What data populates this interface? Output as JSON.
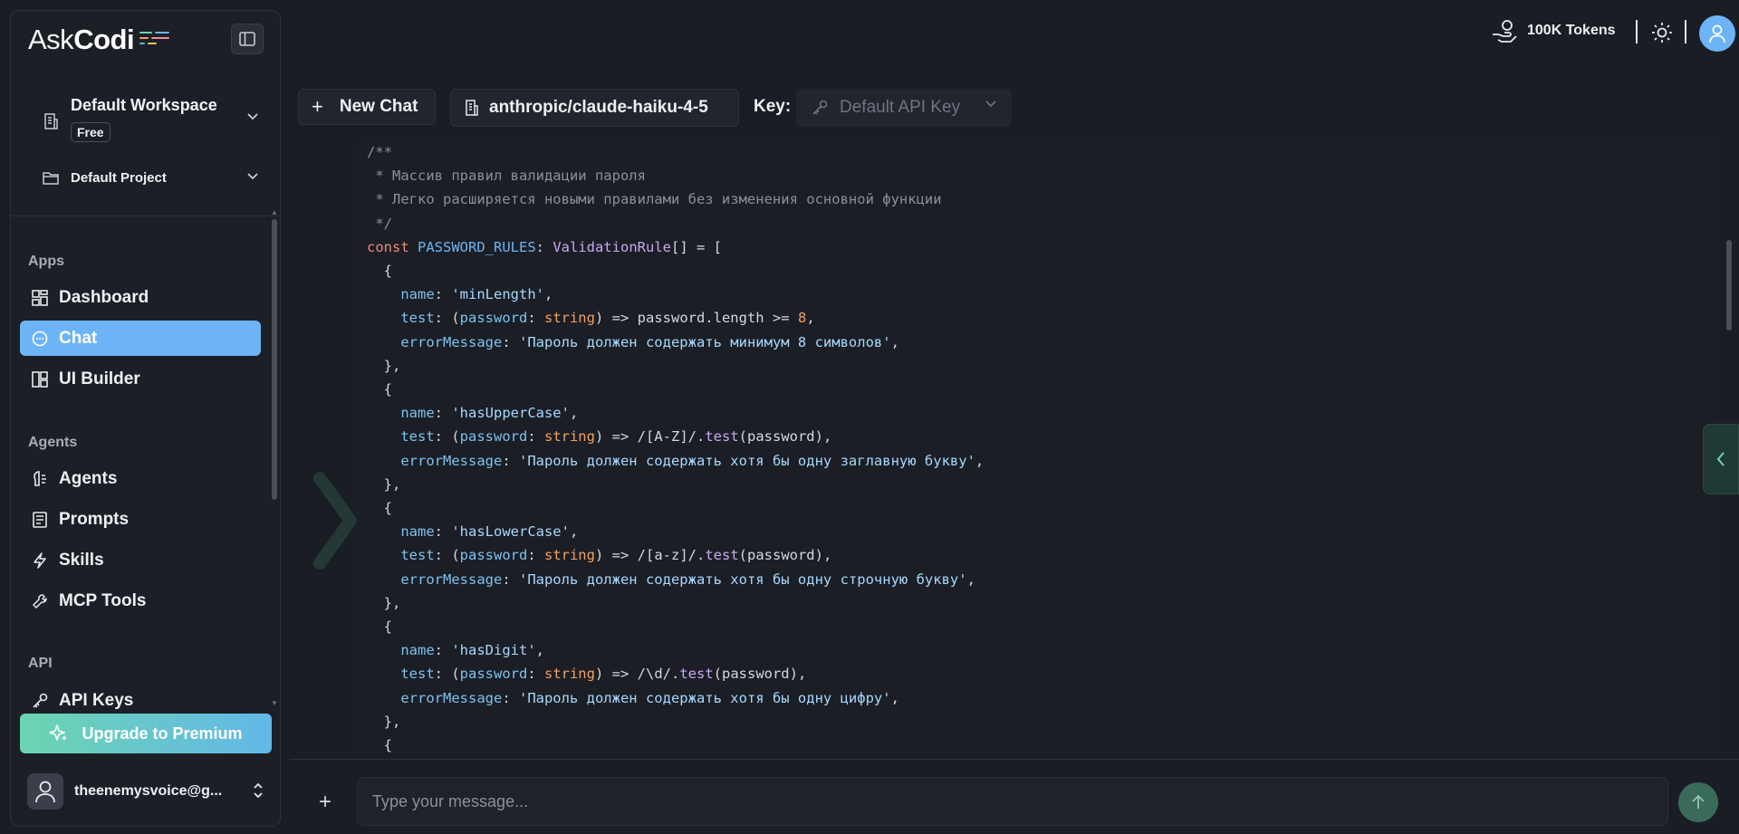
{
  "sidebar": {
    "logo": {
      "ask": "Ask",
      "codi": "Codi"
    },
    "workspace": {
      "name": "Default Workspace",
      "plan": "Free"
    },
    "project": {
      "name": "Default Project"
    },
    "sections": {
      "apps": "Apps",
      "agents": "Agents",
      "api": "API"
    },
    "items": {
      "dashboard": "Dashboard",
      "chat": "Chat",
      "ui_builder": "UI Builder",
      "agents": "Agents",
      "prompts": "Prompts",
      "skills": "Skills",
      "mcp_tools": "MCP Tools",
      "api_keys": "API Keys"
    },
    "upgrade_label": "Upgrade to Premium",
    "user_email": "theenemysvoice@g..."
  },
  "topbar": {
    "tokens": "100K Tokens"
  },
  "toolbar": {
    "new_chat": "New Chat",
    "model": "anthropic/claude-haiku-4-5",
    "key_label": "Key:",
    "key_placeholder": "Default API Key"
  },
  "composer": {
    "placeholder": "Type your message..."
  },
  "colors": {
    "accent": "#6cb4f5",
    "upgrade_start": "#6cd4b0",
    "upgrade_end": "#62b8e8",
    "background": "#1a1d24"
  },
  "code": {
    "c1": "/**",
    "c2": " * Массив правил валидации пароля",
    "c3": " * Легко расширяется новыми правилами без изменения основной функции",
    "c4": " */",
    "const_kw": "const",
    "const_name": "PASSWORD_RULES",
    "const_type": "ValidationRule",
    "rules": [
      {
        "name": "'minLength'",
        "test_body": "password.length >= ",
        "test_num": "8",
        "error": "'Пароль должен содержать минимум 8 символов'"
      },
      {
        "name": "'hasUpperCase'",
        "regex": "/[A-Z]/",
        "error": "'Пароль должен содержать хотя бы одну заглавную букву'"
      },
      {
        "name": "'hasLowerCase'",
        "regex": "/[a-z]/",
        "error": "'Пароль должен содержать хотя бы одну строчную букву'"
      },
      {
        "name": "'hasDigit'",
        "regex": "/\\d/",
        "error": "'Пароль должен содержать хотя бы одну цифру'"
      }
    ]
  }
}
